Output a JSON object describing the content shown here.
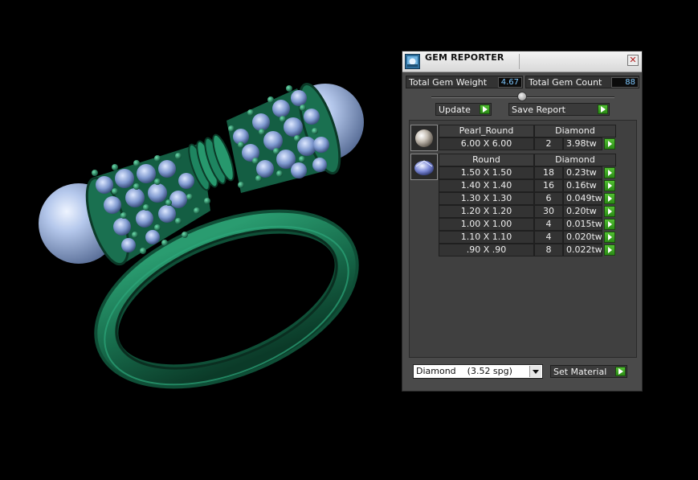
{
  "window": {
    "title": "GEM REPORTER",
    "close_glyph": "✕"
  },
  "stats": {
    "total_weight_label": "Total Gem Weight",
    "total_weight_value": "4.67",
    "total_count_label": "Total Gem Count",
    "total_count_value": "88"
  },
  "actions": {
    "update_label": "Update",
    "save_report_label": "Save Report"
  },
  "groups": [
    {
      "shape": "Pearl_Round",
      "material": "Diamond",
      "icon": "pearl-icon",
      "rows": [
        {
          "size": "6.00 X 6.00",
          "count": "2",
          "weight": "3.98tw"
        }
      ]
    },
    {
      "shape": "Round",
      "material": "Diamond",
      "icon": "diamond-icon",
      "rows": [
        {
          "size": "1.50 X 1.50",
          "count": "18",
          "weight": "0.23tw"
        },
        {
          "size": "1.40 X 1.40",
          "count": "16",
          "weight": "0.16tw"
        },
        {
          "size": "1.30 X 1.30",
          "count": "6",
          "weight": "0.049tw"
        },
        {
          "size": "1.20 X 1.20",
          "count": "30",
          "weight": "0.20tw"
        },
        {
          "size": "1.00 X 1.00",
          "count": "4",
          "weight": "0.015tw"
        },
        {
          "size": "1.10 X 1.10",
          "count": "4",
          "weight": "0.020tw"
        },
        {
          "size": ".90 X .90",
          "count": "8",
          "weight": "0.022tw"
        }
      ]
    }
  ],
  "material_select": {
    "selected": "Diamond    (3.52 spg)"
  },
  "set_material_label": "Set Material",
  "colors": {
    "ring_metal": "#1e7a57",
    "pearl": "#a9bfe6",
    "panel_bg": "#4a4a4a",
    "go_button": "#3aa322",
    "value_text": "#7ec8ff"
  }
}
